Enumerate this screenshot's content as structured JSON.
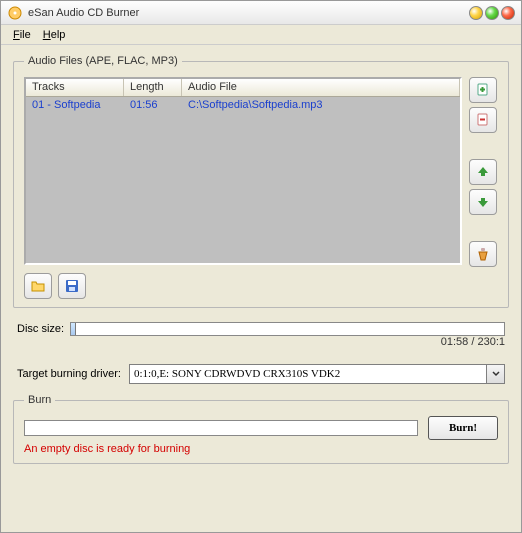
{
  "window": {
    "title": "eSan Audio CD Burner"
  },
  "menu": {
    "file": "File",
    "help": "Help"
  },
  "audio_group": {
    "legend": "Audio Files (APE, FLAC, MP3)",
    "columns": {
      "tracks": "Tracks",
      "length": "Length",
      "file": "Audio File"
    },
    "rows": [
      {
        "tracks": "01 - Softpedia",
        "length": "01:56",
        "file": "C:\\Softpedia\\Softpedia.mp3"
      }
    ]
  },
  "disc": {
    "label": "Disc size:",
    "usage": "01:58 / 230:1",
    "fill_percent": 1.2
  },
  "target": {
    "label": "Target burning driver:",
    "selected": "0:1:0,E: SONY     CDRWDVD CRX310S  VDK2"
  },
  "burn": {
    "legend": "Burn",
    "button": "Burn!",
    "status": "An empty disc is ready for burning"
  },
  "icons": {
    "add": "add-file-icon",
    "remove": "remove-file-icon",
    "up": "move-up-icon",
    "down": "move-down-icon",
    "clear": "clear-list-icon",
    "open": "open-folder-icon",
    "save": "save-icon"
  }
}
